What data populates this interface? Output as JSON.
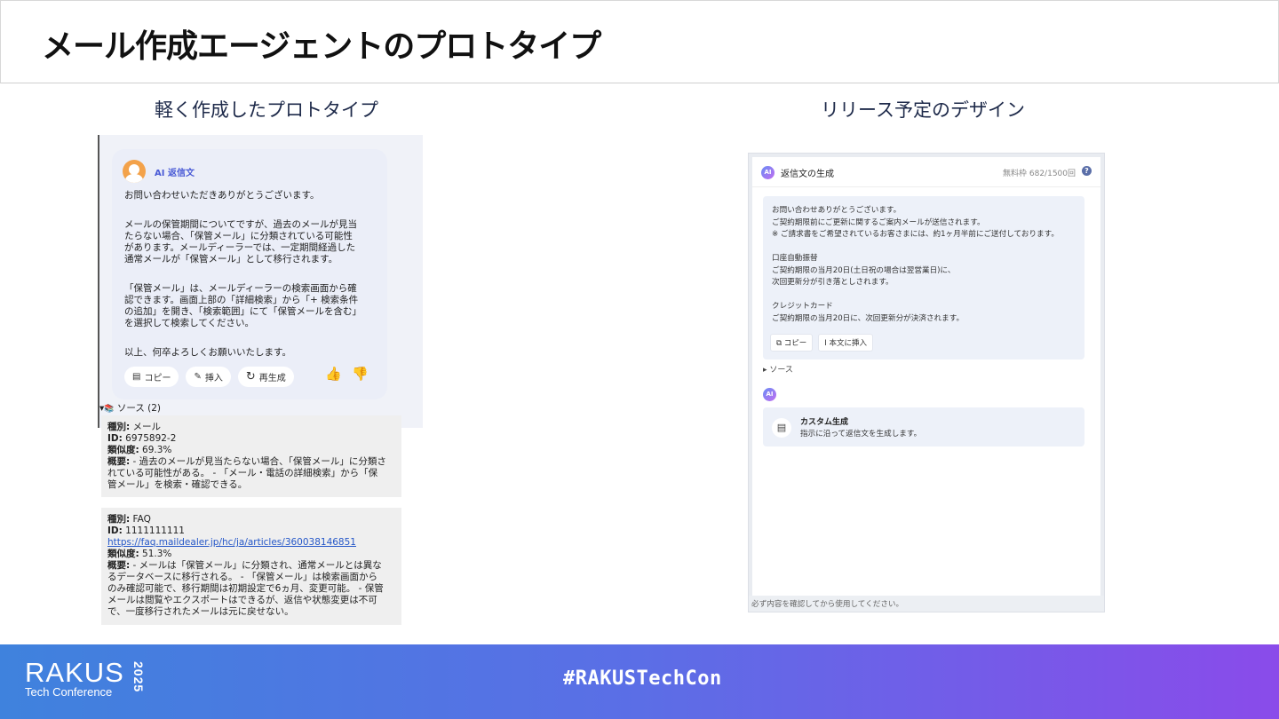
{
  "header": {
    "title": "メール作成エージェントのプロトタイプ"
  },
  "columns": {
    "left_title": "軽く作成したプロトタイプ",
    "right_title": "リリース予定のデザイン"
  },
  "prototype": {
    "ai_label": "AI 返信文",
    "greeting": "お問い合わせいただきありがとうございます。",
    "para1": [
      "メールの保管期間についてですが、過去のメールが見当",
      "たらない場合、「保管メール」に分類されている可能性",
      "があります。メールディーラーでは、一定期間経過した",
      "通常メールが「保管メール」として移行されます。"
    ],
    "para2": [
      "「保管メール」は、メールディーラーの検索画面から確",
      "認できます。画面上部の「詳細検索」から「+ 検索条件",
      "の追加」を開き、「検索範囲」にて「保管メールを含む」",
      "を選択して検索してください。"
    ],
    "closing": "以上、何卒よろしくお願いいたします。",
    "buttons": {
      "copy": "コピー",
      "insert": "挿入",
      "regenerate": "再生成"
    },
    "sources_toggle": "ソース (2)",
    "sources": [
      {
        "type_label": "種別:",
        "type": "メール",
        "id_label": "ID:",
        "id": "6975892-2",
        "sim_label": "類似度:",
        "sim": "69.3%",
        "summary_label": "概要:",
        "summary": [
          "- 過去のメールが見当たらない場合、「保管メール」に分類さ",
          "れている可能性がある。 - 「メール・電話の詳細検索」から「保",
          "管メール」を検索・確認できる。"
        ]
      },
      {
        "type_label": "種別:",
        "type": "FAQ",
        "id_label": "ID:",
        "id": "1111111111",
        "link": "https://faq.maildealer.jp/hc/ja/articles/360038146851",
        "sim_label": "類似度:",
        "sim": "51.3%",
        "summary_label": "概要:",
        "summary": [
          "- メールは「保管メール」に分類され、通常メールとは異な",
          "るデータベースに移行される。 - 「保管メール」は検索画面から",
          "のみ確認可能で、移行期間は初期設定で6ヵ月、変更可能。 - 保管",
          "メールは閲覧やエクスポートはできるが、返信や状態変更は不可",
          "で、一度移行されたメールは元に戻せない。"
        ]
      }
    ]
  },
  "design": {
    "ai_badge": "AI",
    "title": "返信文の生成",
    "quota": "無料枠 682/1500回",
    "quota_icon": "?",
    "body": [
      "お問い合わせありがとうございます。",
      "ご契約期限前にご更新に関するご案内メールが送信されます。",
      "※ ご請求書をご希望されているお客さまには、約1ヶ月半前にご送付しております。",
      "",
      "口座自動振替",
      "ご契約期限の当月20日(土日祝の場合は翌営業日)に、",
      "次回更新分が引き落としされます。",
      "",
      "クレジットカード",
      "ご契約期限の当月20日に、次回更新分が決済されます。"
    ],
    "buttons": {
      "copy": "コピー",
      "insert": "本文に挿入"
    },
    "source": "▸ ソース",
    "custom_title": "カスタム生成",
    "custom_sub": "指示に沿って返信文を生成します。",
    "footer_note": "必ず内容を確認してから使用してください。"
  },
  "footer": {
    "logo_main": "RAKUS",
    "logo_sub": "Tech Conference",
    "logo_year": "2025",
    "hashtag": "#RAKUSTechCon"
  }
}
